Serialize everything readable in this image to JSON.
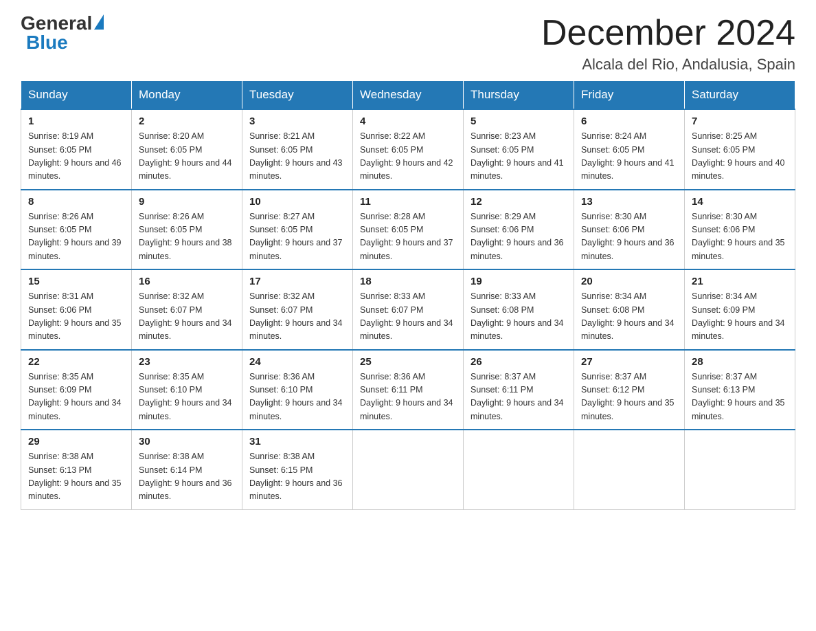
{
  "logo": {
    "general": "General",
    "blue": "Blue",
    "triangle": true
  },
  "header": {
    "month_year": "December 2024",
    "location": "Alcala del Rio, Andalusia, Spain"
  },
  "weekdays": [
    "Sunday",
    "Monday",
    "Tuesday",
    "Wednesday",
    "Thursday",
    "Friday",
    "Saturday"
  ],
  "weeks": [
    [
      {
        "day": "1",
        "sunrise": "8:19 AM",
        "sunset": "6:05 PM",
        "daylight": "9 hours and 46 minutes."
      },
      {
        "day": "2",
        "sunrise": "8:20 AM",
        "sunset": "6:05 PM",
        "daylight": "9 hours and 44 minutes."
      },
      {
        "day": "3",
        "sunrise": "8:21 AM",
        "sunset": "6:05 PM",
        "daylight": "9 hours and 43 minutes."
      },
      {
        "day": "4",
        "sunrise": "8:22 AM",
        "sunset": "6:05 PM",
        "daylight": "9 hours and 42 minutes."
      },
      {
        "day": "5",
        "sunrise": "8:23 AM",
        "sunset": "6:05 PM",
        "daylight": "9 hours and 41 minutes."
      },
      {
        "day": "6",
        "sunrise": "8:24 AM",
        "sunset": "6:05 PM",
        "daylight": "9 hours and 41 minutes."
      },
      {
        "day": "7",
        "sunrise": "8:25 AM",
        "sunset": "6:05 PM",
        "daylight": "9 hours and 40 minutes."
      }
    ],
    [
      {
        "day": "8",
        "sunrise": "8:26 AM",
        "sunset": "6:05 PM",
        "daylight": "9 hours and 39 minutes."
      },
      {
        "day": "9",
        "sunrise": "8:26 AM",
        "sunset": "6:05 PM",
        "daylight": "9 hours and 38 minutes."
      },
      {
        "day": "10",
        "sunrise": "8:27 AM",
        "sunset": "6:05 PM",
        "daylight": "9 hours and 37 minutes."
      },
      {
        "day": "11",
        "sunrise": "8:28 AM",
        "sunset": "6:05 PM",
        "daylight": "9 hours and 37 minutes."
      },
      {
        "day": "12",
        "sunrise": "8:29 AM",
        "sunset": "6:06 PM",
        "daylight": "9 hours and 36 minutes."
      },
      {
        "day": "13",
        "sunrise": "8:30 AM",
        "sunset": "6:06 PM",
        "daylight": "9 hours and 36 minutes."
      },
      {
        "day": "14",
        "sunrise": "8:30 AM",
        "sunset": "6:06 PM",
        "daylight": "9 hours and 35 minutes."
      }
    ],
    [
      {
        "day": "15",
        "sunrise": "8:31 AM",
        "sunset": "6:06 PM",
        "daylight": "9 hours and 35 minutes."
      },
      {
        "day": "16",
        "sunrise": "8:32 AM",
        "sunset": "6:07 PM",
        "daylight": "9 hours and 34 minutes."
      },
      {
        "day": "17",
        "sunrise": "8:32 AM",
        "sunset": "6:07 PM",
        "daylight": "9 hours and 34 minutes."
      },
      {
        "day": "18",
        "sunrise": "8:33 AM",
        "sunset": "6:07 PM",
        "daylight": "9 hours and 34 minutes."
      },
      {
        "day": "19",
        "sunrise": "8:33 AM",
        "sunset": "6:08 PM",
        "daylight": "9 hours and 34 minutes."
      },
      {
        "day": "20",
        "sunrise": "8:34 AM",
        "sunset": "6:08 PM",
        "daylight": "9 hours and 34 minutes."
      },
      {
        "day": "21",
        "sunrise": "8:34 AM",
        "sunset": "6:09 PM",
        "daylight": "9 hours and 34 minutes."
      }
    ],
    [
      {
        "day": "22",
        "sunrise": "8:35 AM",
        "sunset": "6:09 PM",
        "daylight": "9 hours and 34 minutes."
      },
      {
        "day": "23",
        "sunrise": "8:35 AM",
        "sunset": "6:10 PM",
        "daylight": "9 hours and 34 minutes."
      },
      {
        "day": "24",
        "sunrise": "8:36 AM",
        "sunset": "6:10 PM",
        "daylight": "9 hours and 34 minutes."
      },
      {
        "day": "25",
        "sunrise": "8:36 AM",
        "sunset": "6:11 PM",
        "daylight": "9 hours and 34 minutes."
      },
      {
        "day": "26",
        "sunrise": "8:37 AM",
        "sunset": "6:11 PM",
        "daylight": "9 hours and 34 minutes."
      },
      {
        "day": "27",
        "sunrise": "8:37 AM",
        "sunset": "6:12 PM",
        "daylight": "9 hours and 35 minutes."
      },
      {
        "day": "28",
        "sunrise": "8:37 AM",
        "sunset": "6:13 PM",
        "daylight": "9 hours and 35 minutes."
      }
    ],
    [
      {
        "day": "29",
        "sunrise": "8:38 AM",
        "sunset": "6:13 PM",
        "daylight": "9 hours and 35 minutes."
      },
      {
        "day": "30",
        "sunrise": "8:38 AM",
        "sunset": "6:14 PM",
        "daylight": "9 hours and 36 minutes."
      },
      {
        "day": "31",
        "sunrise": "8:38 AM",
        "sunset": "6:15 PM",
        "daylight": "9 hours and 36 minutes."
      },
      null,
      null,
      null,
      null
    ]
  ],
  "labels": {
    "sunrise_prefix": "Sunrise: ",
    "sunset_prefix": "Sunset: ",
    "daylight_prefix": "Daylight: "
  }
}
